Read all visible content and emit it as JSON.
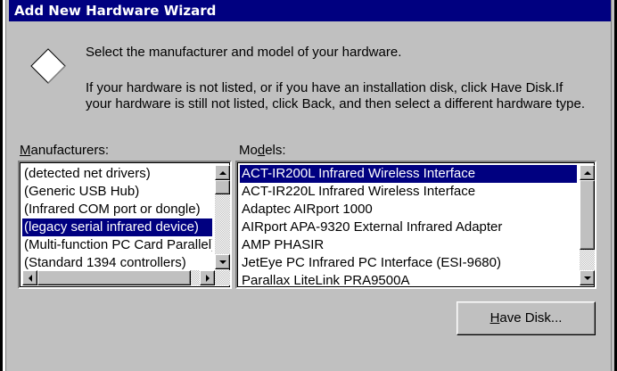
{
  "window": {
    "title": "Add New Hardware Wizard"
  },
  "prompt": {
    "heading": "Select the manufacturer and model of your hardware.",
    "info": "If your hardware is not listed, or if you have an installation disk, click Have Disk.If your hardware is still not listed, click Back, and then select a different hardware type."
  },
  "manufacturers": {
    "label_prefix": "",
    "label_hotkey": "M",
    "label_rest": "anufacturers:",
    "items": [
      "(detected net drivers)",
      "(Generic USB Hub)",
      "(Infrared COM port or dongle)",
      "(legacy serial infrared device)",
      "(Multi-function PC Card Parallel)",
      "(Standard 1394 controllers)"
    ],
    "selected_index": 3
  },
  "models": {
    "label_prefix": "Mo",
    "label_hotkey": "d",
    "label_rest": "els:",
    "items": [
      "ACT-IR200L Infrared Wireless Interface",
      "ACT-IR220L Infrared Wireless Interface",
      "Adaptec AIRport 1000",
      "AIRport APA-9320 External Infrared Adapter",
      "AMP PHASIR",
      "JetEye PC Infrared PC Interface (ESI-9680)",
      "Parallax LiteLink PRA9500A"
    ],
    "selected_index": 0
  },
  "buttons": {
    "have_disk_hotkey": "H",
    "have_disk_rest": "ave Disk..."
  },
  "colors": {
    "titlebar": "#000080",
    "dialog_face": "#c0c0c0",
    "selection": "#000080"
  }
}
